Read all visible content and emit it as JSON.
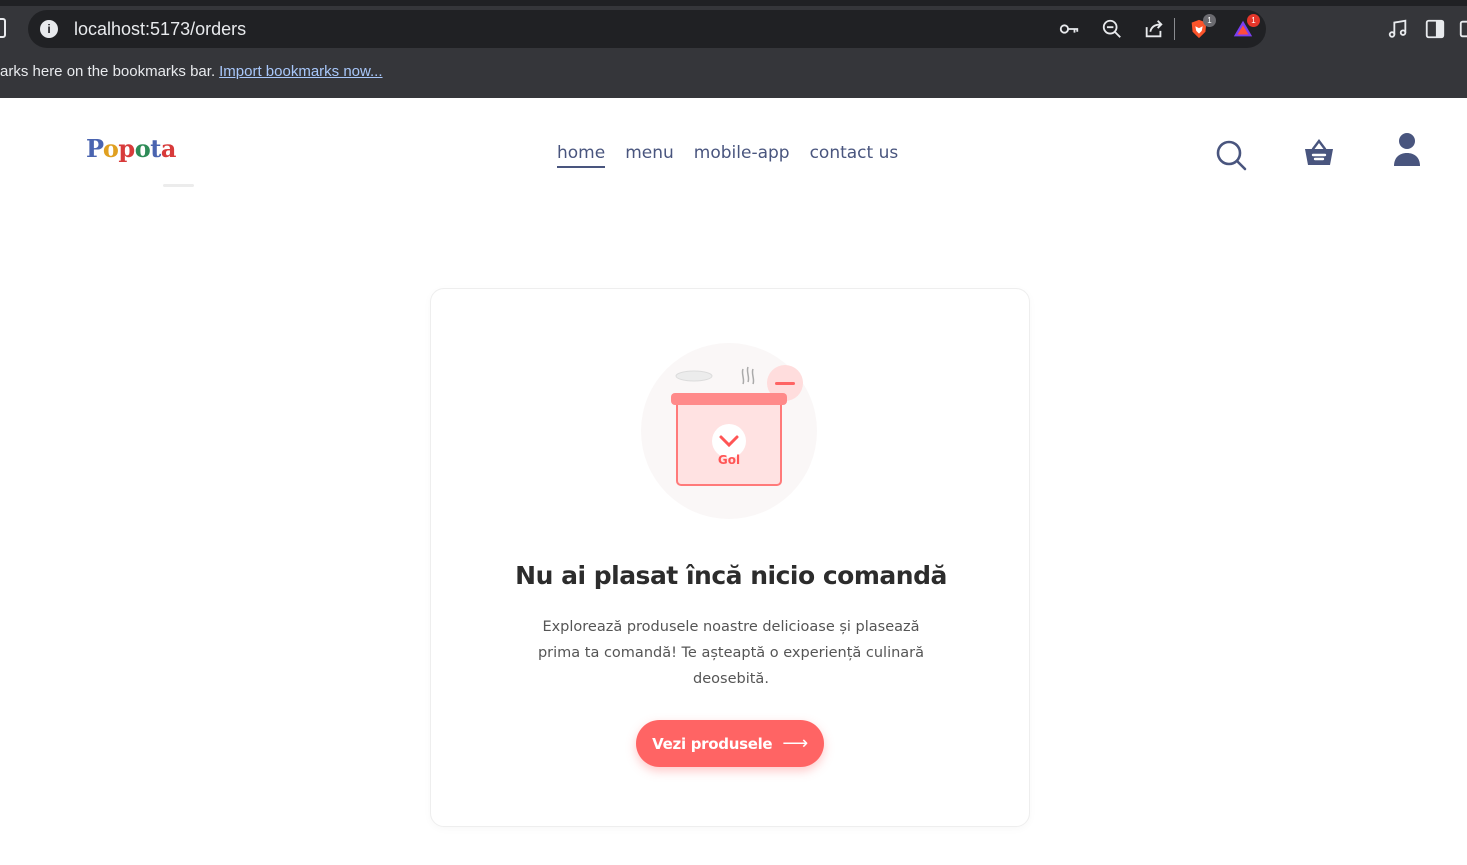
{
  "browser": {
    "url": "localhost:5173/orders",
    "bookmarks_text": "arks here on the bookmarks bar.",
    "bookmarks_link": "Import bookmarks now...",
    "brave_badge": "1",
    "rewards_badge": "1"
  },
  "site": {
    "logo": [
      "P",
      "o",
      "p",
      "o",
      "t",
      "a"
    ],
    "nav": [
      {
        "label": "home",
        "active": true
      },
      {
        "label": "menu"
      },
      {
        "label": "mobile-app"
      },
      {
        "label": "contact us"
      }
    ],
    "icons": [
      "search-icon",
      "basket-icon",
      "user-icon"
    ]
  },
  "empty_state": {
    "illustration_label": "Gol",
    "title": "Nu ai plasat încă nicio comandă",
    "text": "Explorează produsele noastre delicioase și plasează prima ta comandă! Te așteaptă o experiență culinară deosebită.",
    "button_label": "Vezi produsele",
    "button_arrow": "⟶"
  },
  "colors": {
    "accent": "#ff6464",
    "nav_text": "#49557e",
    "chrome_bg": "#35363a",
    "omnibox_bg": "#202124"
  }
}
